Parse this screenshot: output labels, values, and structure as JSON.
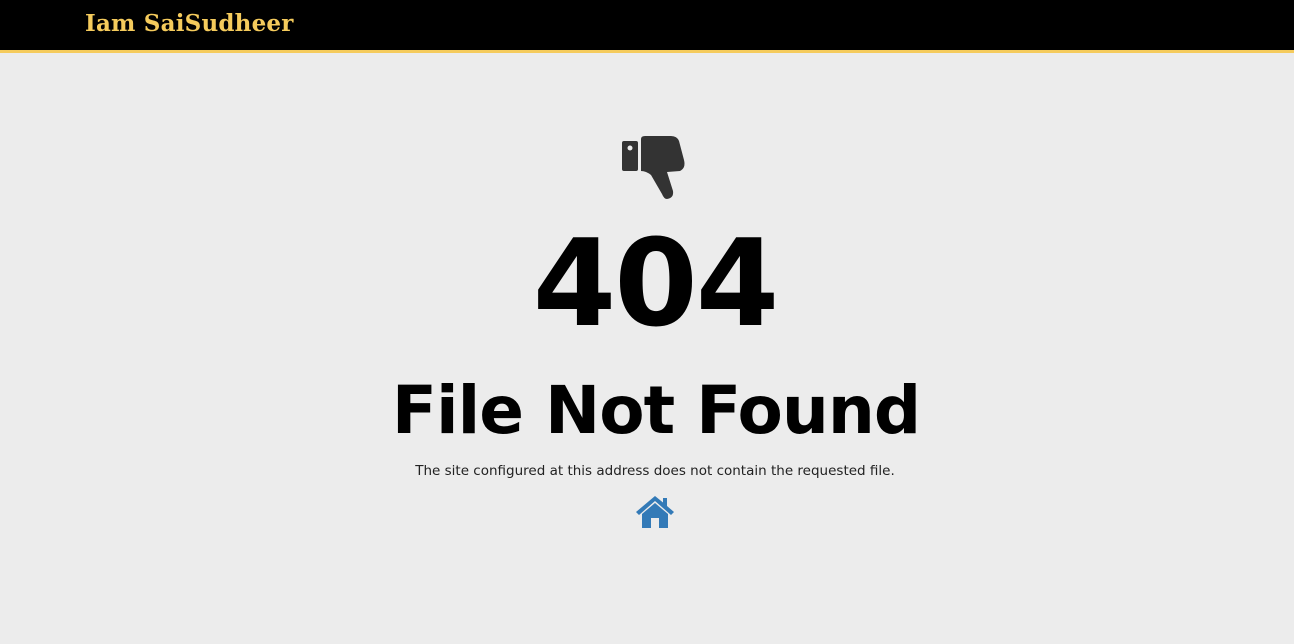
{
  "header": {
    "brand": "Iam SaiSudheer",
    "brand_color": "#f5cb5c",
    "background": "#000000"
  },
  "error": {
    "icon": "thumbs-down-icon",
    "code": "404",
    "title": "File Not Found",
    "description": "The site configured at this address does not contain the requested file.",
    "home_link_icon": "home-icon",
    "home_icon_color": "#337ab7"
  }
}
